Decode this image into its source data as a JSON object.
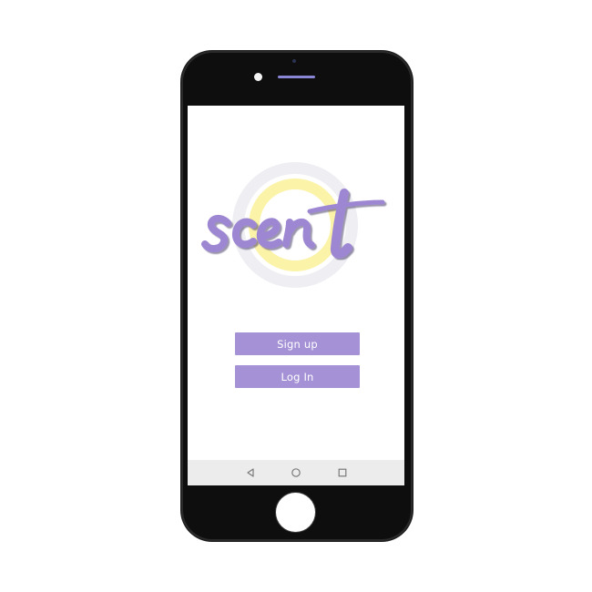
{
  "app": {
    "logo_text": "scent"
  },
  "buttons": {
    "signup_label": "Sign up",
    "login_label": "Log In"
  },
  "navbar": {
    "back_icon": "back-triangle-icon",
    "home_icon": "home-circle-icon",
    "recent_icon": "recent-square-icon"
  },
  "colors": {
    "accent": "#a592d6",
    "logo_purple": "#9d87d2",
    "ring_yellow": "#fbf3a8",
    "ring_gray": "#eeeef3",
    "phone_body": "#0e0e0e",
    "navbar_bg": "#ececec"
  }
}
